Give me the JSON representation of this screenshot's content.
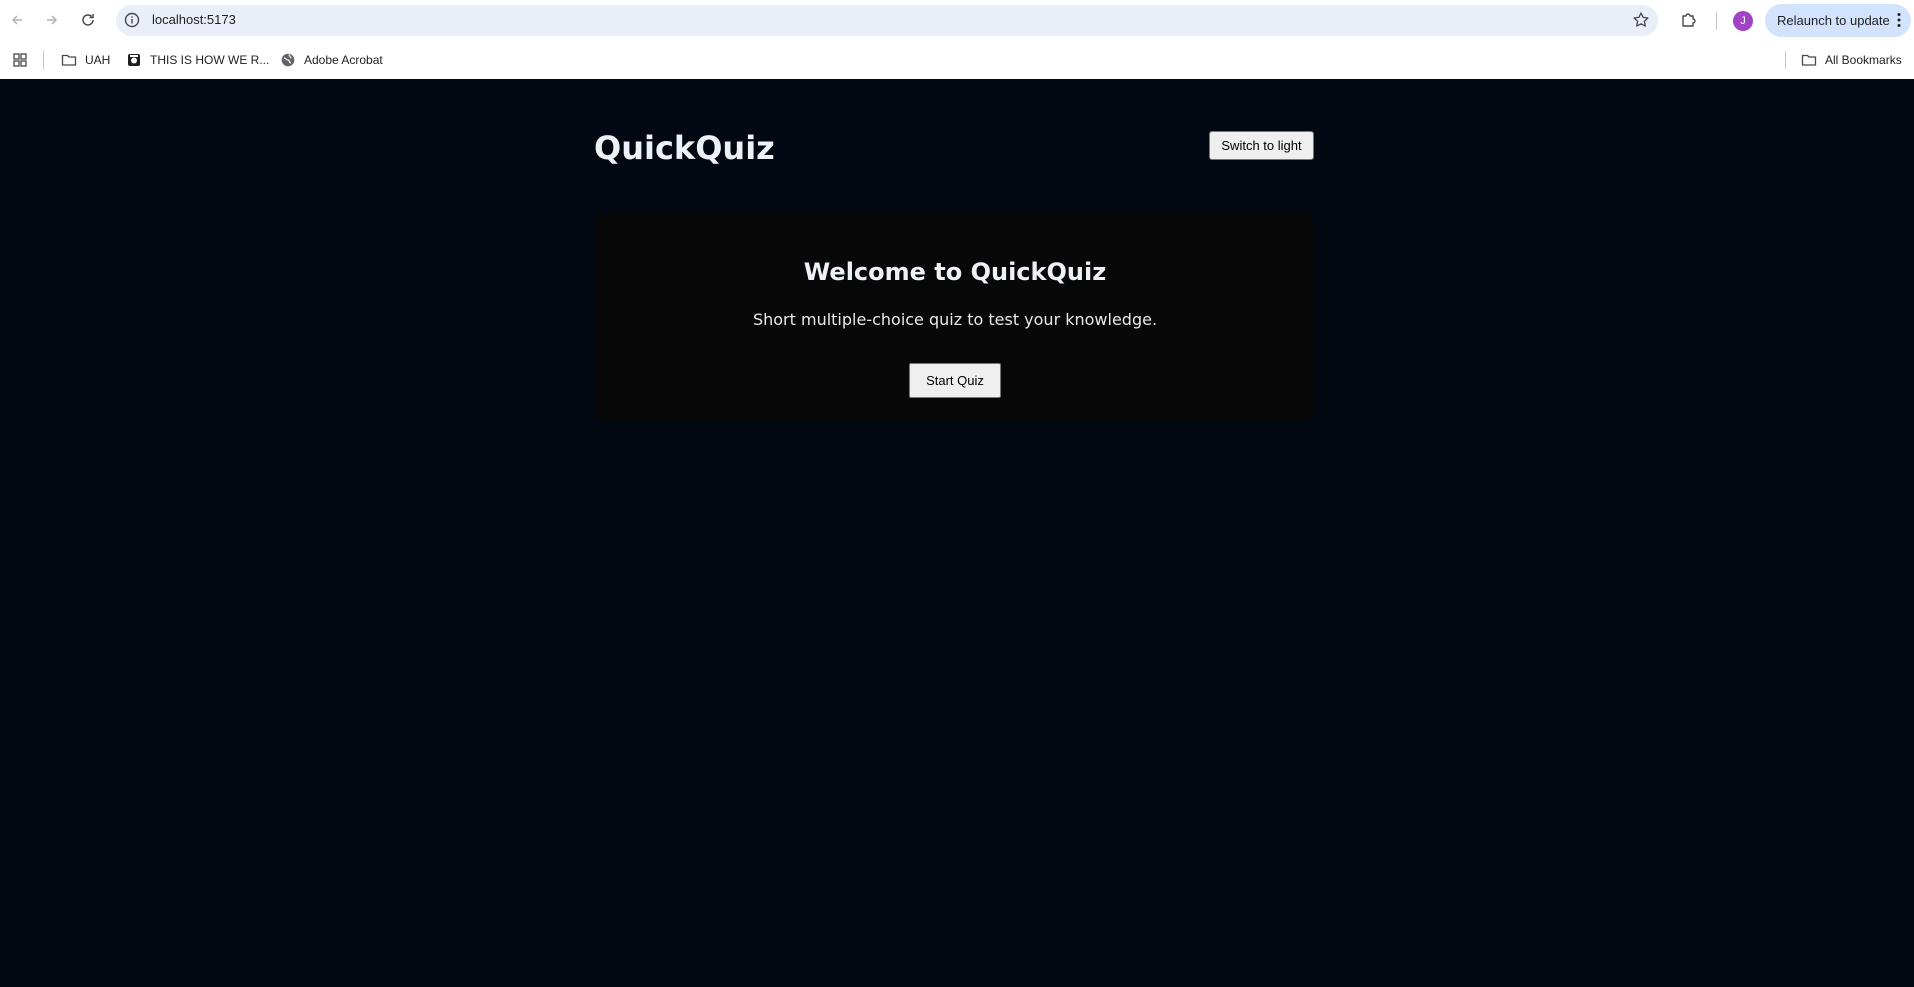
{
  "browser": {
    "url": "localhost:5173",
    "relaunch_label": "Relaunch to update",
    "avatar_initial": "J",
    "bookmarks": [
      {
        "label": "UAH",
        "icon": "folder-icon"
      },
      {
        "label": "THIS IS HOW WE R...",
        "icon": "site-favicon-icon"
      },
      {
        "label": "Adobe Acrobat",
        "icon": "globe-icon"
      }
    ],
    "all_bookmarks_label": "All Bookmarks"
  },
  "app": {
    "title": "QuickQuiz",
    "theme_toggle_label": "Switch to light",
    "welcome": {
      "heading": "Welcome to QuickQuiz",
      "description": "Short multiple-choice quiz to test your knowledge.",
      "start_label": "Start Quiz"
    }
  },
  "colors": {
    "page_background": "#020913",
    "card_background": "#080808",
    "avatar": "#a142c7",
    "relaunch_chip": "#d3e3fd"
  }
}
